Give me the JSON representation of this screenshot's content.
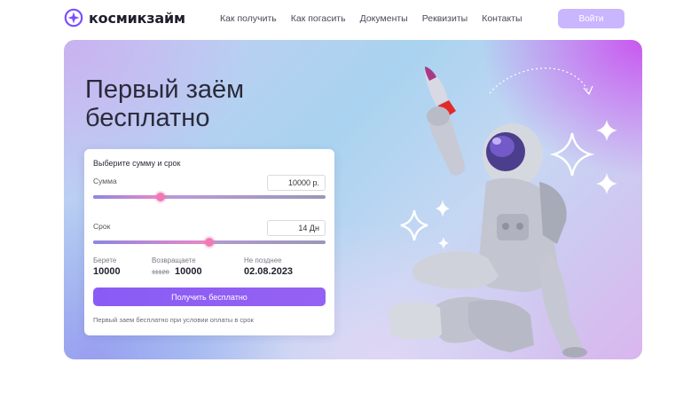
{
  "header": {
    "logo_text": "космикзайм",
    "nav": [
      "Как получить",
      "Как погасить",
      "Документы",
      "Реквизиты",
      "Контакты"
    ],
    "login_label": "Войти"
  },
  "hero": {
    "title_line1": "Первый заём",
    "title_line2": "бесплатно"
  },
  "calculator": {
    "title": "Выберите сумму и срок",
    "amount": {
      "label": "Сумма",
      "value": "10000 р.",
      "slider_fraction": 0.29
    },
    "term": {
      "label": "Срок",
      "value": "14 Дн",
      "slider_fraction": 0.5
    },
    "borrow": {
      "caption": "Берете",
      "value": "10000"
    },
    "repay": {
      "caption": "Возвращаете",
      "old_value": "11120",
      "value": "10000"
    },
    "deadline": {
      "caption": "Не позднее",
      "value": "02.08.2023"
    },
    "cta_label": "Получить бесплатно",
    "note": "Первый заем бесплатно при условии оплаты в срок"
  },
  "colors": {
    "brand": "#7c4dff",
    "button": "#8a5cf6",
    "login_bg": "#c9b6ff",
    "slider_thumb": "#f07ab4"
  },
  "icons": [
    "logo-star-icon",
    "astronaut-illustration",
    "rocket-icon",
    "sparkle-icon"
  ]
}
